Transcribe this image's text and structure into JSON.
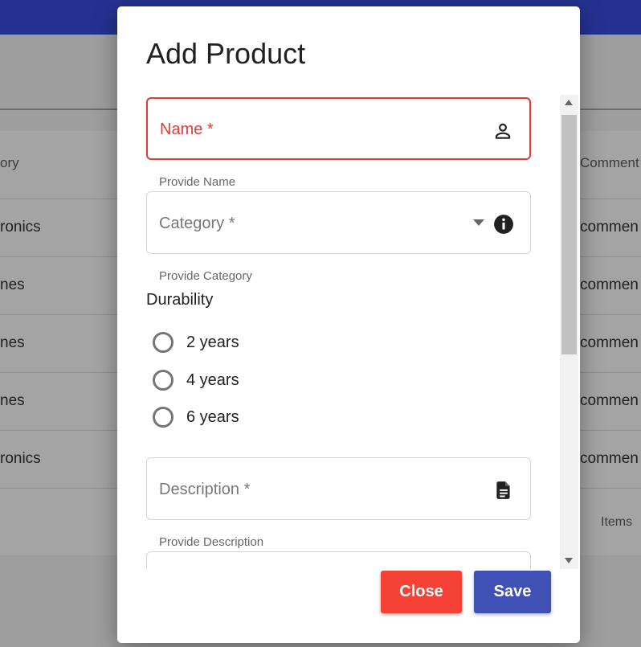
{
  "background": {
    "table": {
      "left_header": "ory",
      "right_header": "Comment",
      "left_rows": [
        "ronics",
        "nes",
        "nes",
        "nes",
        "ronics"
      ],
      "right_rows": [
        "commen",
        "commen",
        "commen",
        "commen",
        "commen"
      ],
      "footer": "Items"
    }
  },
  "dialog": {
    "title": "Add Product",
    "name_field": {
      "label": "Name *",
      "helper": "Provide Name",
      "icon": "person-icon"
    },
    "category_field": {
      "label": "Category *",
      "helper": "Provide Category",
      "icon": "info-icon"
    },
    "durability": {
      "label": "Durability",
      "options": [
        "2 years",
        "4 years",
        "6 years"
      ]
    },
    "description_field": {
      "label": "Description *",
      "helper": "Provide Description",
      "icon": "document-icon"
    },
    "buttons": {
      "close": "Close",
      "save": "Save"
    }
  },
  "colors": {
    "app_bar": "#243191",
    "error": "#e53935",
    "close_button": "#f44336",
    "save_button": "#3f51b5"
  }
}
